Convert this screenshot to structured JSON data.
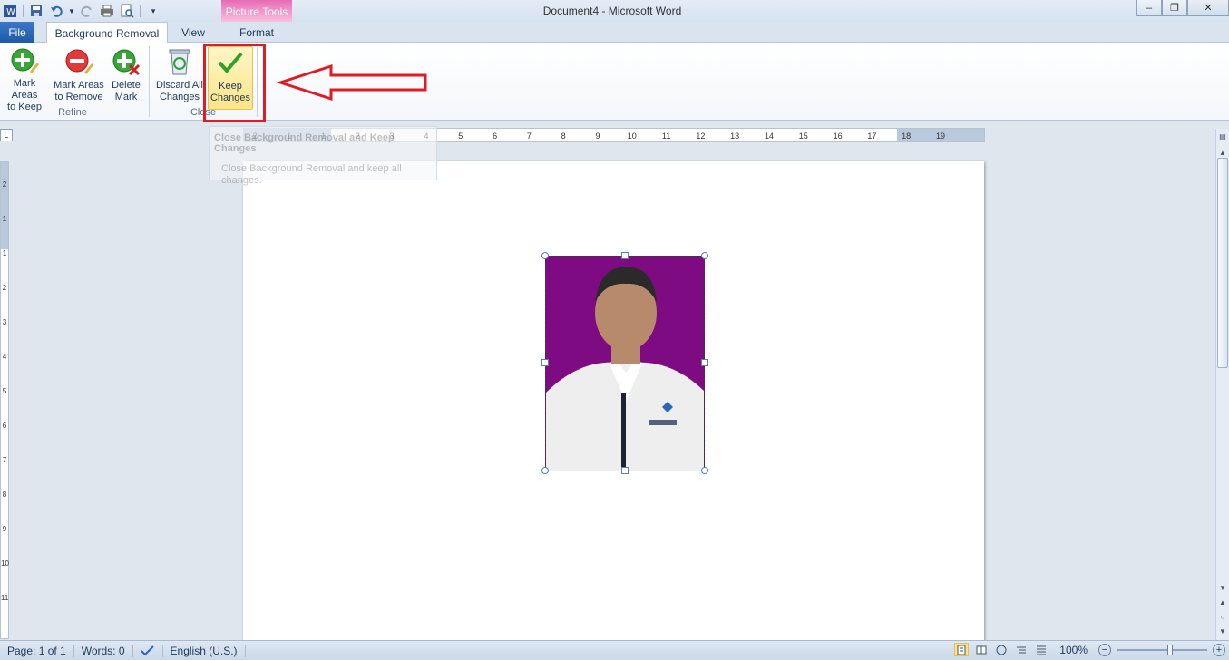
{
  "window": {
    "title": "Document4 - Microsoft Word",
    "context_tab_group": "Picture Tools",
    "controls": {
      "minimize": "–",
      "maximize": "❐",
      "close": "✕"
    }
  },
  "tabs": {
    "file": "File",
    "background_removal": "Background Removal",
    "view": "View",
    "format": "Format"
  },
  "ribbon": {
    "refine": {
      "label": "Refine",
      "mark_keep": [
        "Mark Areas",
        "to Keep"
      ],
      "mark_remove": [
        "Mark Areas",
        "to Remove"
      ],
      "delete_mark": [
        "Delete",
        "Mark"
      ]
    },
    "close": {
      "label": "Close",
      "discard": [
        "Discard All",
        "Changes"
      ],
      "keep": [
        "Keep",
        "Changes"
      ]
    },
    "colors": {
      "highlight": "#e01b24",
      "photo_background": "#7f0b82"
    }
  },
  "tooltip": {
    "title": "Close Background Removal and Keep Changes",
    "body": [
      "Close Background Removal and keep all",
      "changes."
    ]
  },
  "ruler": {
    "h_ticks": [
      "2",
      "1",
      "1",
      "2",
      "3",
      "4",
      "5",
      "6",
      "7",
      "8",
      "9",
      "10",
      "11",
      "12",
      "13",
      "14",
      "15",
      "16",
      "17",
      "18",
      "19"
    ],
    "v_ticks": [
      "2",
      "1",
      "1",
      "2",
      "3",
      "4",
      "5",
      "6",
      "7",
      "8",
      "9",
      "10",
      "11"
    ]
  },
  "status": {
    "page": "Page: 1 of 1",
    "words": "Words: 0",
    "language": "English (U.S.)",
    "zoom": "100%",
    "zoom_out": "−",
    "zoom_in": "+"
  }
}
